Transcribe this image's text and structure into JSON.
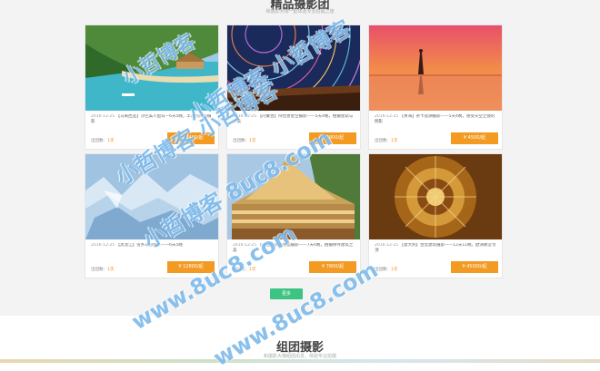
{
  "header": {
    "title": "精品摄影团",
    "subtitle": "和摄影大咖一起体验专业拍摄之旅"
  },
  "cards": [
    {
      "date": "2016-12-25",
      "desc": "【马来西亚】沙巴美人鱼岛—6天5晚，丰富的海岛摄影",
      "people_label": "出团数：",
      "people": "1次",
      "price": "¥ 12400/起"
    },
    {
      "date": "2016-12-25",
      "desc": "【内蒙古】阿拉善星空摄影——5天4晚，拍摄星轨与沙漠",
      "people_label": "出团数：",
      "people": "1次",
      "price": "¥ 5800/起"
    },
    {
      "date": "2016-12-25",
      "desc": "【青海】茶卡盐湖摄影——5天4晚，感受天空之镜的倒影",
      "people_label": "出团数：",
      "people": "1次",
      "price": "¥ 4500/起"
    },
    {
      "date": "2016-12-25",
      "desc": "【黑龙江】雪乡冰雪摄影——6天5晚",
      "people_label": "出团数：",
      "people": "1次",
      "price": "¥ 12800/起"
    },
    {
      "date": "2016-12-25",
      "desc": "【泰国】清迈寺庙摄影——7天6晚，拍摄佛寺建筑之美",
      "people_label": "出团数：",
      "people": "1次",
      "price": "¥ 7800/起"
    },
    {
      "date": "2016-12-25",
      "desc": "【意大利】古堡建筑摄影——12天11晚，欧洲教堂穹顶",
      "people_label": "出团数：",
      "people": "1次",
      "price": "¥ 45000/起"
    }
  ],
  "more_button": "更多",
  "section2": {
    "title": "组团摄影",
    "subtitle": "和摄影大咖组团出发，体验专业拍摄"
  },
  "watermarks": [
    "小哲博客",
    "小哲博客 小哲博客",
    "小哲博客 小哲博客",
    "小哲博客 8uc8.com",
    "www.8uc8.com",
    "www.8uc8.com"
  ]
}
